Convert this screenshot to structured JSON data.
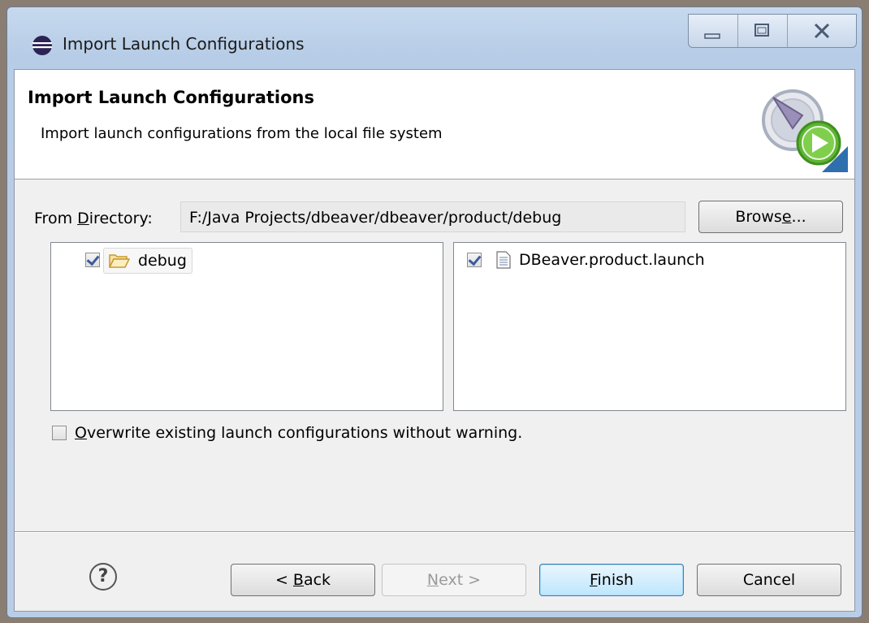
{
  "window": {
    "title": "Import Launch Configurations",
    "controls": [
      "minimize",
      "maximize",
      "close"
    ]
  },
  "banner": {
    "title": "Import Launch Configurations",
    "description": "Import launch configurations from the local file system",
    "icon": "launch-wizard-icon"
  },
  "directory": {
    "label_pre": "From ",
    "label_mnemonic": "D",
    "label_post": "irectory:",
    "value": "F:/Java Projects/dbeaver/dbeaver/product/debug",
    "browse_pre": "Brows",
    "browse_mnemonic": "e",
    "browse_post": "..."
  },
  "tree": {
    "folder_name": "debug",
    "folder_checked": true
  },
  "files": [
    {
      "name": "DBeaver.product.launch",
      "checked": true
    }
  ],
  "overwrite": {
    "mnemonic": "O",
    "label_rest": "verwrite existing launch configurations without warning.",
    "checked": false
  },
  "buttons": {
    "back_pre": "< ",
    "back_mnemonic": "B",
    "back_post": "ack",
    "next_mnemonic": "N",
    "next_post": "ext >",
    "finish_mnemonic": "F",
    "finish_post": "inish",
    "cancel": "Cancel"
  },
  "help_icon": "?"
}
